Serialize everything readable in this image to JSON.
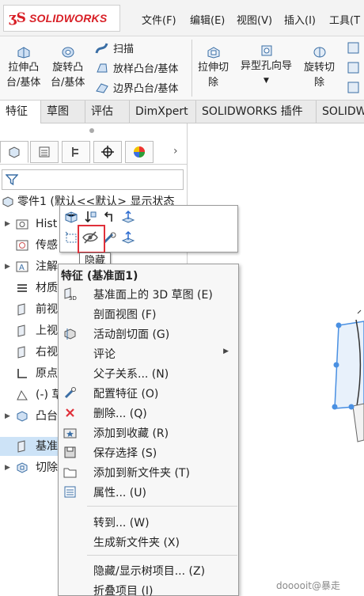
{
  "app": {
    "logo_ds": "ʒS",
    "logo_text": "SOLIDWORKS"
  },
  "menu": [
    "文件(F)",
    "编辑(E)",
    "视图(V)",
    "插入(I)",
    "工具(T"
  ],
  "ribbon": {
    "extrude_boss": [
      "拉伸凸",
      "台/基体"
    ],
    "revolve_boss": [
      "旋转凸",
      "台/基体"
    ],
    "sweep": "扫描",
    "loft": "放样凸台/基体",
    "boundary": "边界凸台/基体",
    "extrude_cut": [
      "拉伸切",
      "除"
    ],
    "hole_wizard": "异型孔向导",
    "revolve_cut": [
      "旋转切",
      "除"
    ]
  },
  "tabs": [
    "特征",
    "草图",
    "评估",
    "DimXpert",
    "SOLIDWORKS 插件",
    "SOLIDW"
  ],
  "tree": {
    "root": "零件1 (默认<<默认> 显示状态",
    "items": [
      "Hist",
      "传感",
      "注解",
      "材质",
      "前视",
      "上视",
      "右视",
      "原点",
      "(-) 草",
      "凸台",
      "基准",
      "切除"
    ]
  },
  "tooltip": "隐藏",
  "context_menu": {
    "title": "特征 (基准面1)",
    "items": [
      {
        "label": "基准面上的 3D 草图 (E)",
        "icon": "3d-sketch-icon"
      },
      {
        "label": "剖面视图 (F)",
        "icon": ""
      },
      {
        "label": "活动剖切面 (G)",
        "icon": "section-plane-icon"
      },
      {
        "label": "评论",
        "icon": ""
      },
      {
        "label": "父子关系... (N)",
        "icon": ""
      },
      {
        "label": "配置特征 (O)",
        "icon": "configure-icon"
      },
      {
        "label": "删除... (Q)",
        "icon": "delete-icon"
      },
      {
        "label": "添加到收藏 (R)",
        "icon": "favorite-icon"
      },
      {
        "label": "保存选择 (S)",
        "icon": "save-selection-icon"
      },
      {
        "label": "添加到新文件夹 (T)",
        "icon": "folder-icon"
      },
      {
        "label": "属性... (U)",
        "icon": "properties-icon"
      },
      {
        "label": "转到... (W)",
        "icon": ""
      },
      {
        "label": "生成新文件夹 (X)",
        "icon": ""
      },
      {
        "label": "隐藏/显示树项目... (Z)",
        "icon": ""
      },
      {
        "label": "折叠项目 (I)",
        "icon": ""
      }
    ]
  },
  "watermark": "dooooit@暴走",
  "colors": {
    "accent": "#d81f26",
    "highlight": "#e0303a",
    "selection": "#cde3f7",
    "plane": "#4a90e2"
  }
}
